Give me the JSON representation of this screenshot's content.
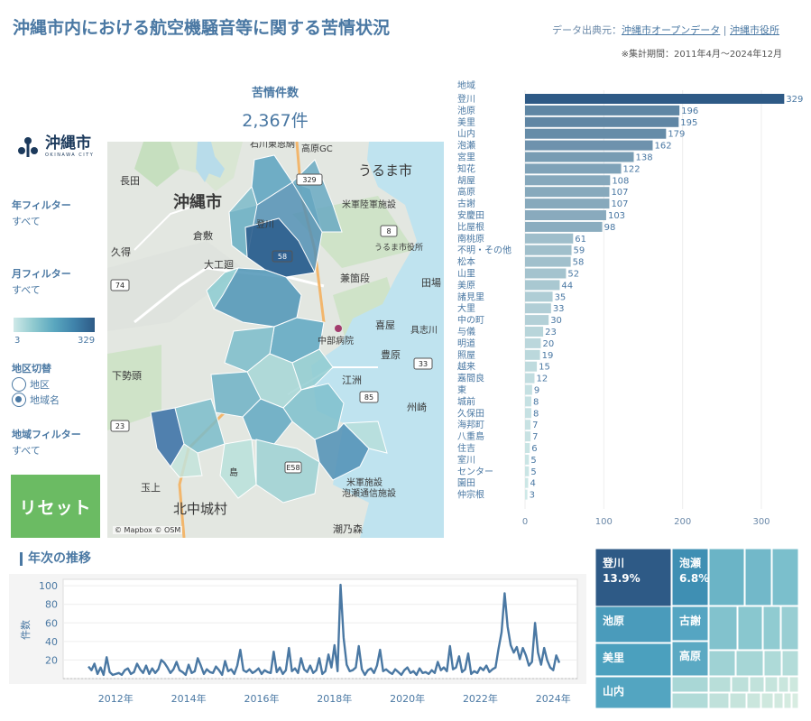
{
  "header": {
    "title": "沖縄市内における航空機騒音等に関する苦情状況",
    "source_prefix": "データ出典元：",
    "source_link1": "沖縄市オープンデータ",
    "source_sep": " | ",
    "source_link2": "沖縄市役所",
    "period": "※集計期間：2011年4月～2024年12月"
  },
  "kpi": {
    "label": "苦情件数",
    "value": "2,367件"
  },
  "logo": {
    "jp": "沖縄市",
    "en": "OKINAWA CITY"
  },
  "filters": {
    "year_label": "年フィルター",
    "year_value": "すべて",
    "month_label": "月フィルター",
    "month_value": "すべて",
    "legend_min": "3",
    "legend_max": "329",
    "district_label": "地区切替",
    "district_options": [
      "地区",
      "地域名"
    ],
    "district_selected": "地域名",
    "area_label": "地域フィルター",
    "area_value": "すべて"
  },
  "reset_label": "リセット",
  "map": {
    "labels": [
      "沖縄市",
      "うるま市",
      "北中城村",
      "長田",
      "倉敷",
      "久得",
      "大工廻",
      "兼箇段",
      "田場",
      "喜屋",
      "豊原",
      "江洲",
      "州崎",
      "下勢頭",
      "玉上",
      "中部病院",
      "うるま市役所",
      "米軍陸軍施設",
      "米軍施設",
      "泡瀬通信施設",
      "具志川",
      "潮乃森",
      "石川東恩納",
      "高原GC",
      "登川",
      "島"
    ],
    "road_labels": [
      "329",
      "8",
      "58",
      "74",
      "33",
      "85",
      "23",
      "E58"
    ],
    "attribution": "© Mapbox © OSM"
  },
  "bar_chart_header": "地域",
  "chart_data": [
    {
      "type": "bar",
      "orientation": "horizontal",
      "categories": [
        "登川",
        "池原",
        "美里",
        "山内",
        "泡瀬",
        "宮里",
        "知花",
        "胡屋",
        "高原",
        "古謝",
        "安慶田",
        "比屋根",
        "南桃原",
        "不明・その他",
        "松本",
        "山里",
        "美原",
        "諸見里",
        "大里",
        "中の町",
        "与儀",
        "明道",
        "照屋",
        "越来",
        "嘉間良",
        "東",
        "城前",
        "久保田",
        "海邦町",
        "八重島",
        "住吉",
        "室川",
        "センター",
        "園田",
        "仲宗根"
      ],
      "values": [
        329,
        196,
        195,
        179,
        162,
        138,
        122,
        108,
        107,
        107,
        103,
        98,
        61,
        59,
        58,
        52,
        44,
        35,
        33,
        30,
        23,
        20,
        19,
        15,
        12,
        9,
        8,
        8,
        7,
        7,
        6,
        5,
        5,
        4,
        3
      ],
      "xticks": [
        0,
        100,
        200,
        300
      ],
      "xlim": [
        0,
        340
      ],
      "grid": true
    },
    {
      "type": "line",
      "title": "年次の推移",
      "ylabel": "件数",
      "yticks": [
        20,
        40,
        60,
        80,
        100
      ],
      "ylim": [
        0,
        105
      ],
      "xticks": [
        "2012年",
        "2014年",
        "2016年",
        "2018年",
        "2020年",
        "2022年",
        "2024年"
      ],
      "x_start": "2011-04",
      "x_end": "2024-12",
      "values": [
        13,
        9,
        16,
        5,
        12,
        4,
        23,
        7,
        4,
        5,
        6,
        4,
        9,
        11,
        5,
        7,
        16,
        10,
        6,
        14,
        5,
        11,
        6,
        10,
        20,
        17,
        12,
        6,
        10,
        18,
        9,
        7,
        4,
        15,
        6,
        8,
        22,
        14,
        5,
        10,
        7,
        6,
        13,
        9,
        4,
        19,
        8,
        10,
        5,
        14,
        31,
        9,
        7,
        10,
        6,
        8,
        11,
        5,
        9,
        7,
        6,
        29,
        7,
        12,
        5,
        9,
        33,
        8,
        11,
        6,
        22,
        10,
        7,
        14,
        6,
        9,
        22,
        5,
        8,
        26,
        12,
        36,
        8,
        101,
        44,
        15,
        8,
        9,
        12,
        35,
        10,
        4,
        9,
        11,
        6,
        14,
        31,
        8,
        10,
        7,
        5,
        10,
        7,
        4,
        9,
        12,
        6,
        8,
        4,
        11,
        6,
        7,
        5,
        9,
        6,
        18,
        9,
        12,
        8,
        35,
        10,
        12,
        24,
        7,
        10,
        27,
        5,
        8,
        6,
        12,
        9,
        14,
        7,
        10,
        12,
        32,
        50,
        92,
        56,
        36,
        28,
        34,
        21,
        33,
        25,
        14,
        18,
        60,
        28,
        15,
        33,
        20,
        12,
        9,
        25,
        17
      ]
    },
    {
      "type": "table",
      "title": "treemap",
      "cells": [
        {
          "name": "登川",
          "pct": "13.9%"
        },
        {
          "name": "泡瀬",
          "pct": "6.8%"
        },
        {
          "name": "池原"
        },
        {
          "name": "古謝"
        },
        {
          "name": "美里"
        },
        {
          "name": "高原"
        },
        {
          "name": "山内"
        }
      ]
    }
  ]
}
